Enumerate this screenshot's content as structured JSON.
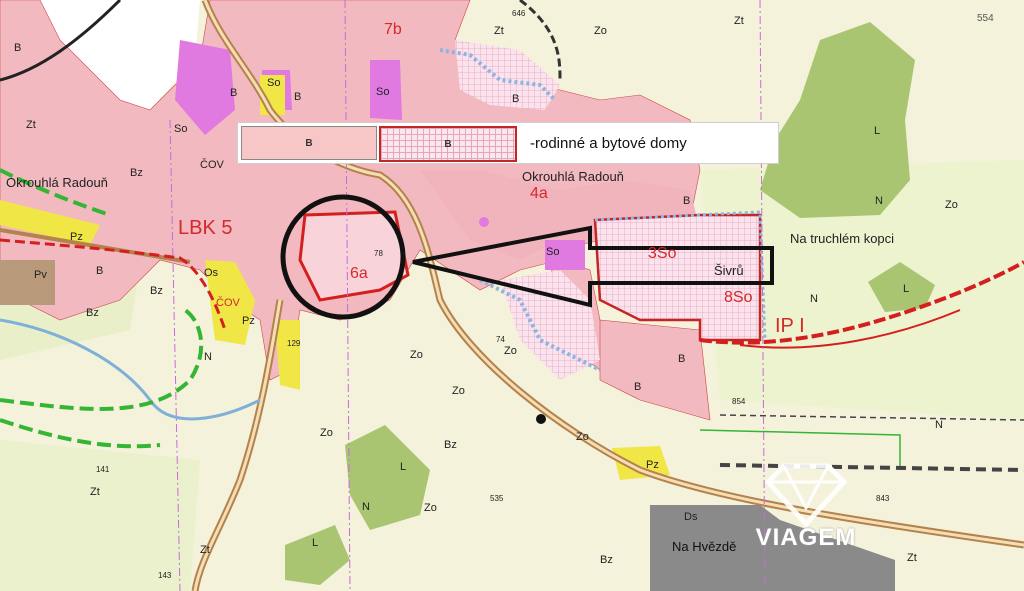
{
  "legend": {
    "swatch_solid_label": "B",
    "swatch_hatched_label": "B",
    "text": "-rodinné a bytové domy"
  },
  "labels": {
    "okrouhla_radoun_left": "Okrouhlá Radouň",
    "okrouhla_radoun_center": "Okrouhlá Radouň",
    "na_truchlem_kopci": "Na truchlém kopci",
    "na_hvezde": "Na Hvězdě",
    "sivru": "Šivrů",
    "lbk": "LBK 5",
    "ip": "IP I",
    "plot_6a": "6a",
    "plot_4a": "4a",
    "plot_7b": "7b",
    "plot_3so": "3So",
    "plot_8so": "8So",
    "zone_so_1": "So",
    "zone_so_2": "So",
    "zone_so_3": "So",
    "zone_so_4": "So",
    "zone_zo_1": "Zo",
    "zone_zo_2": "Zo",
    "zone_zo_3": "Zo",
    "zone_zo_4": "Zo",
    "zone_zo_5": "Zo",
    "zone_zo_6": "Zo",
    "zone_zo_7": "Zo",
    "zone_zo_8": "Zo",
    "zone_zt_1": "Zt",
    "zone_zt_2": "Zt",
    "zone_zt_3": "Zt",
    "zone_zt_4": "Zt",
    "zone_zt_5": "Zt",
    "zone_zt_6": "Zt",
    "zone_b_1": "B",
    "zone_b_2": "B",
    "zone_b_3": "B",
    "zone_b_4": "B",
    "zone_b_5": "B",
    "zone_b_6": "B",
    "zone_b_7": "B",
    "zone_b_8": "B",
    "zone_bz_1": "Bz",
    "zone_bz_2": "Bz",
    "zone_bz_3": "Bz",
    "zone_bz_4": "Bz",
    "zone_bz_5": "Bz",
    "zone_pz_1": "Pz",
    "zone_pz_2": "Pz",
    "zone_pz_3": "Pz",
    "zone_pv": "Pv",
    "zone_os": "Os",
    "zone_cov_1": "ČOV",
    "zone_cov_2": "ČOV",
    "zone_ds": "Ds",
    "zone_l_1": "L",
    "zone_l_2": "L",
    "zone_l_3": "L",
    "zone_l_4": "L",
    "zone_n_1": "N",
    "zone_n_2": "N",
    "zone_n_3": "N",
    "zone_n_4": "N",
    "zone_n_5": "N",
    "num_554": "554",
    "num_646": "646",
    "num_74": "74",
    "num_535": "535",
    "num_843": "843",
    "num_854": "854",
    "num_129": "129",
    "num_141": "141",
    "num_143": "143",
    "num_78": "78"
  },
  "watermark": {
    "brand": "VIAGEM"
  },
  "colors": {
    "build_pink": "#f3b9c0",
    "mixed_magenta": "#e07ae0",
    "forest_green": "#a9c572",
    "yellow": "#f0e646",
    "road_brown": "#b4824c",
    "boundary_red": "#d41f1f",
    "future_blue": "#8db4e2",
    "corridor_green": "#34b534"
  }
}
